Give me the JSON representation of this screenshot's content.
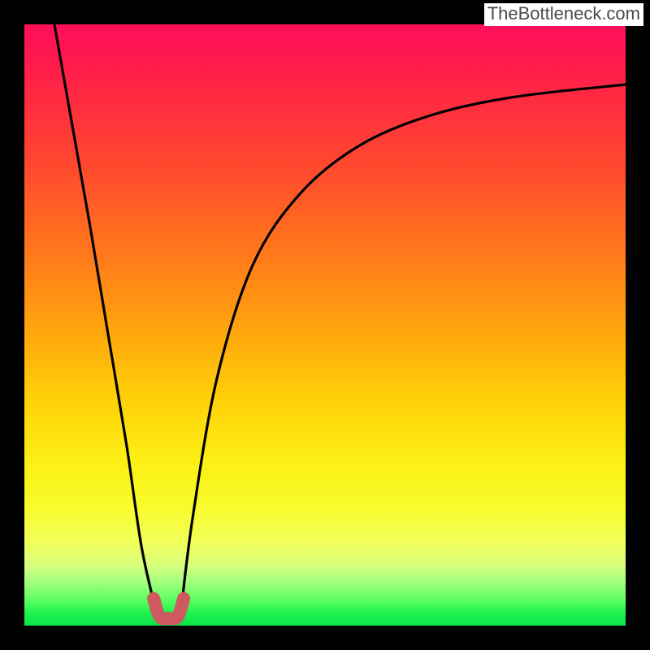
{
  "watermark": "TheBottleneck.com",
  "chart_data": {
    "type": "line",
    "title": "",
    "xlabel": "",
    "ylabel": "",
    "xlim": [
      0,
      100
    ],
    "ylim": [
      0,
      100
    ],
    "grid": false,
    "background_gradient": {
      "direction": "vertical",
      "stops": [
        {
          "pos": 0.0,
          "color": "#ff0f59"
        },
        {
          "pos": 0.24,
          "color": "#ff4a2e"
        },
        {
          "pos": 0.53,
          "color": "#ffad0c"
        },
        {
          "pos": 0.8,
          "color": "#f8fb2a"
        },
        {
          "pos": 0.93,
          "color": "#9cff7d"
        },
        {
          "pos": 1.0,
          "color": "#0be44c"
        }
      ]
    },
    "series": [
      {
        "name": "left-branch",
        "x": [
          5,
          8,
          11,
          14,
          17,
          19.5,
          22
        ],
        "values": [
          100,
          83,
          66,
          48,
          30,
          13,
          2
        ]
      },
      {
        "name": "right-branch",
        "x": [
          26,
          28,
          32,
          38,
          46,
          56,
          68,
          82,
          100
        ],
        "values": [
          2,
          18,
          41,
          60,
          72,
          80,
          85,
          88,
          90
        ]
      },
      {
        "name": "minimum-marker",
        "x": [
          21.5,
          22.5,
          24,
          25.5,
          26.5
        ],
        "values": [
          4.5,
          1.5,
          1.2,
          1.5,
          4.5
        ],
        "note": "short U-shaped mark at trough"
      }
    ],
    "annotation_colors": {
      "curve": "#000000",
      "minimum_marker": "#cc5a5e"
    }
  }
}
